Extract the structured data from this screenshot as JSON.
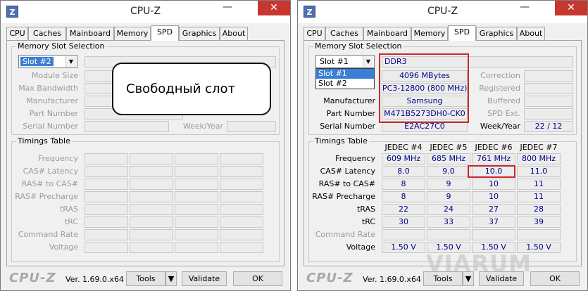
{
  "left": {
    "title": "CPU-Z",
    "tabs": [
      "CPU",
      "Caches",
      "Mainboard",
      "Memory",
      "SPD",
      "Graphics",
      "About"
    ],
    "slot_section": "Memory Slot Selection",
    "slot_value": "Slot #2",
    "labels": [
      "Module Size",
      "Max Bandwidth",
      "Manufacturer",
      "Part Number",
      "Serial Number"
    ],
    "week_year_label": "Week/Year",
    "timings_title": "Timings Table",
    "timing_labels": [
      "Frequency",
      "CAS# Latency",
      "RAS# to CAS#",
      "RAS# Precharge",
      "tRAS",
      "tRC",
      "Command Rate",
      "Voltage"
    ],
    "callout_text": "Свободный слот",
    "footer": {
      "brand": "CPU-Z",
      "version": "Ver. 1.69.0.x64",
      "tools": "Tools",
      "validate": "Validate",
      "ok": "OK"
    }
  },
  "right": {
    "title": "CPU-Z",
    "tabs": [
      "CPU",
      "Caches",
      "Mainboard",
      "Memory",
      "SPD",
      "Graphics",
      "About"
    ],
    "slot_section": "Memory Slot Selection",
    "slot_value": "Slot #1",
    "dropdown_options": [
      "Slot #1",
      "Slot #2"
    ],
    "mem_type": "DDR3",
    "module_size": "4096 MBytes",
    "max_bandwidth": "PC3-12800 (800 MHz)",
    "manufacturer_label": "Manufacturer",
    "manufacturer": "Samsung",
    "part_number_label": "Part Number",
    "part_number": "M471B5273DH0-CK0",
    "serial_number_label": "Serial Number",
    "serial_number": "E2AC27C0",
    "right_labels": [
      "Correction",
      "Registered",
      "Buffered",
      "SPD Ext."
    ],
    "week_year_label": "Week/Year",
    "week_year": "22 / 12",
    "timings_title": "Timings Table",
    "columns": [
      "JEDEC #4",
      "JEDEC #5",
      "JEDEC #6",
      "JEDEC #7"
    ],
    "rows": [
      {
        "label": "Frequency",
        "values": [
          "609 MHz",
          "685 MHz",
          "761 MHz",
          "800 MHz"
        ],
        "dim": false
      },
      {
        "label": "CAS# Latency",
        "values": [
          "8.0",
          "9.0",
          "10.0",
          "11.0"
        ],
        "dim": false
      },
      {
        "label": "RAS# to CAS#",
        "values": [
          "8",
          "9",
          "10",
          "11"
        ],
        "dim": false
      },
      {
        "label": "RAS# Precharge",
        "values": [
          "8",
          "9",
          "10",
          "11"
        ],
        "dim": false
      },
      {
        "label": "tRAS",
        "values": [
          "22",
          "24",
          "27",
          "28"
        ],
        "dim": false
      },
      {
        "label": "tRC",
        "values": [
          "30",
          "33",
          "37",
          "39"
        ],
        "dim": false
      },
      {
        "label": "Command Rate",
        "values": [
          "",
          "",
          "",
          ""
        ],
        "dim": true
      },
      {
        "label": "Voltage",
        "values": [
          "1.50 V",
          "1.50 V",
          "1.50 V",
          "1.50 V"
        ],
        "dim": false
      }
    ],
    "footer": {
      "brand": "CPU-Z",
      "version": "Ver. 1.69.0.x64",
      "tools": "Tools",
      "validate": "Validate",
      "ok": "OK"
    }
  },
  "watermark": "VIARUM",
  "colors": {
    "highlight": "#3a7fd5",
    "red_box": "#c92a2a",
    "value_text": "#00008b",
    "close_button": "#c7372f"
  }
}
